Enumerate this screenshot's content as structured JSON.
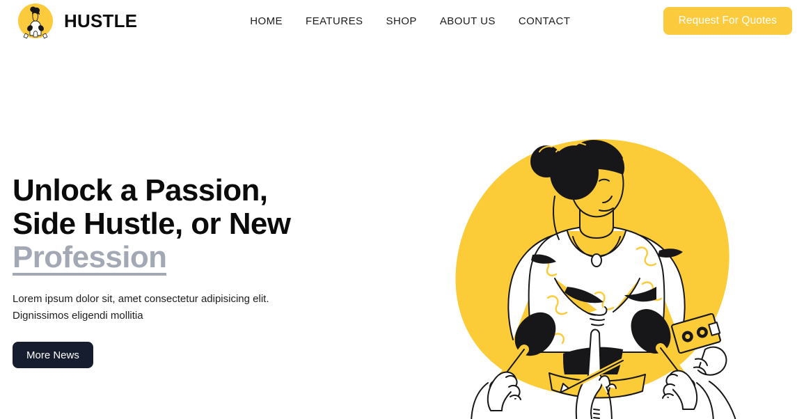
{
  "brand": {
    "name": "HUSTLE",
    "logo_icon": "hustle-interview-badge-icon"
  },
  "nav": {
    "items": [
      {
        "label": "HOME"
      },
      {
        "label": "FEATURES"
      },
      {
        "label": "SHOP"
      },
      {
        "label": "ABOUT US"
      },
      {
        "label": "CONTACT"
      }
    ]
  },
  "header": {
    "cta_label": "Request For Quotes"
  },
  "hero": {
    "headline_line1": "Unlock a Passion,",
    "headline_line2": "Side Hustle, or New",
    "headline_accent": "Profession",
    "paragraph": "Lorem ipsum dolor sit, amet consectetur adipisicing elit. Dignissimos eligendi mollitia",
    "button_label": "More News",
    "illustration_icon": "woman-press-interview-illustration"
  },
  "colors": {
    "brand_yellow": "#fccb3d",
    "ink": "#0b0b0b",
    "accent_grey": "#a2a9b4",
    "dark_navy": "#161d2e",
    "white": "#ffffff"
  }
}
